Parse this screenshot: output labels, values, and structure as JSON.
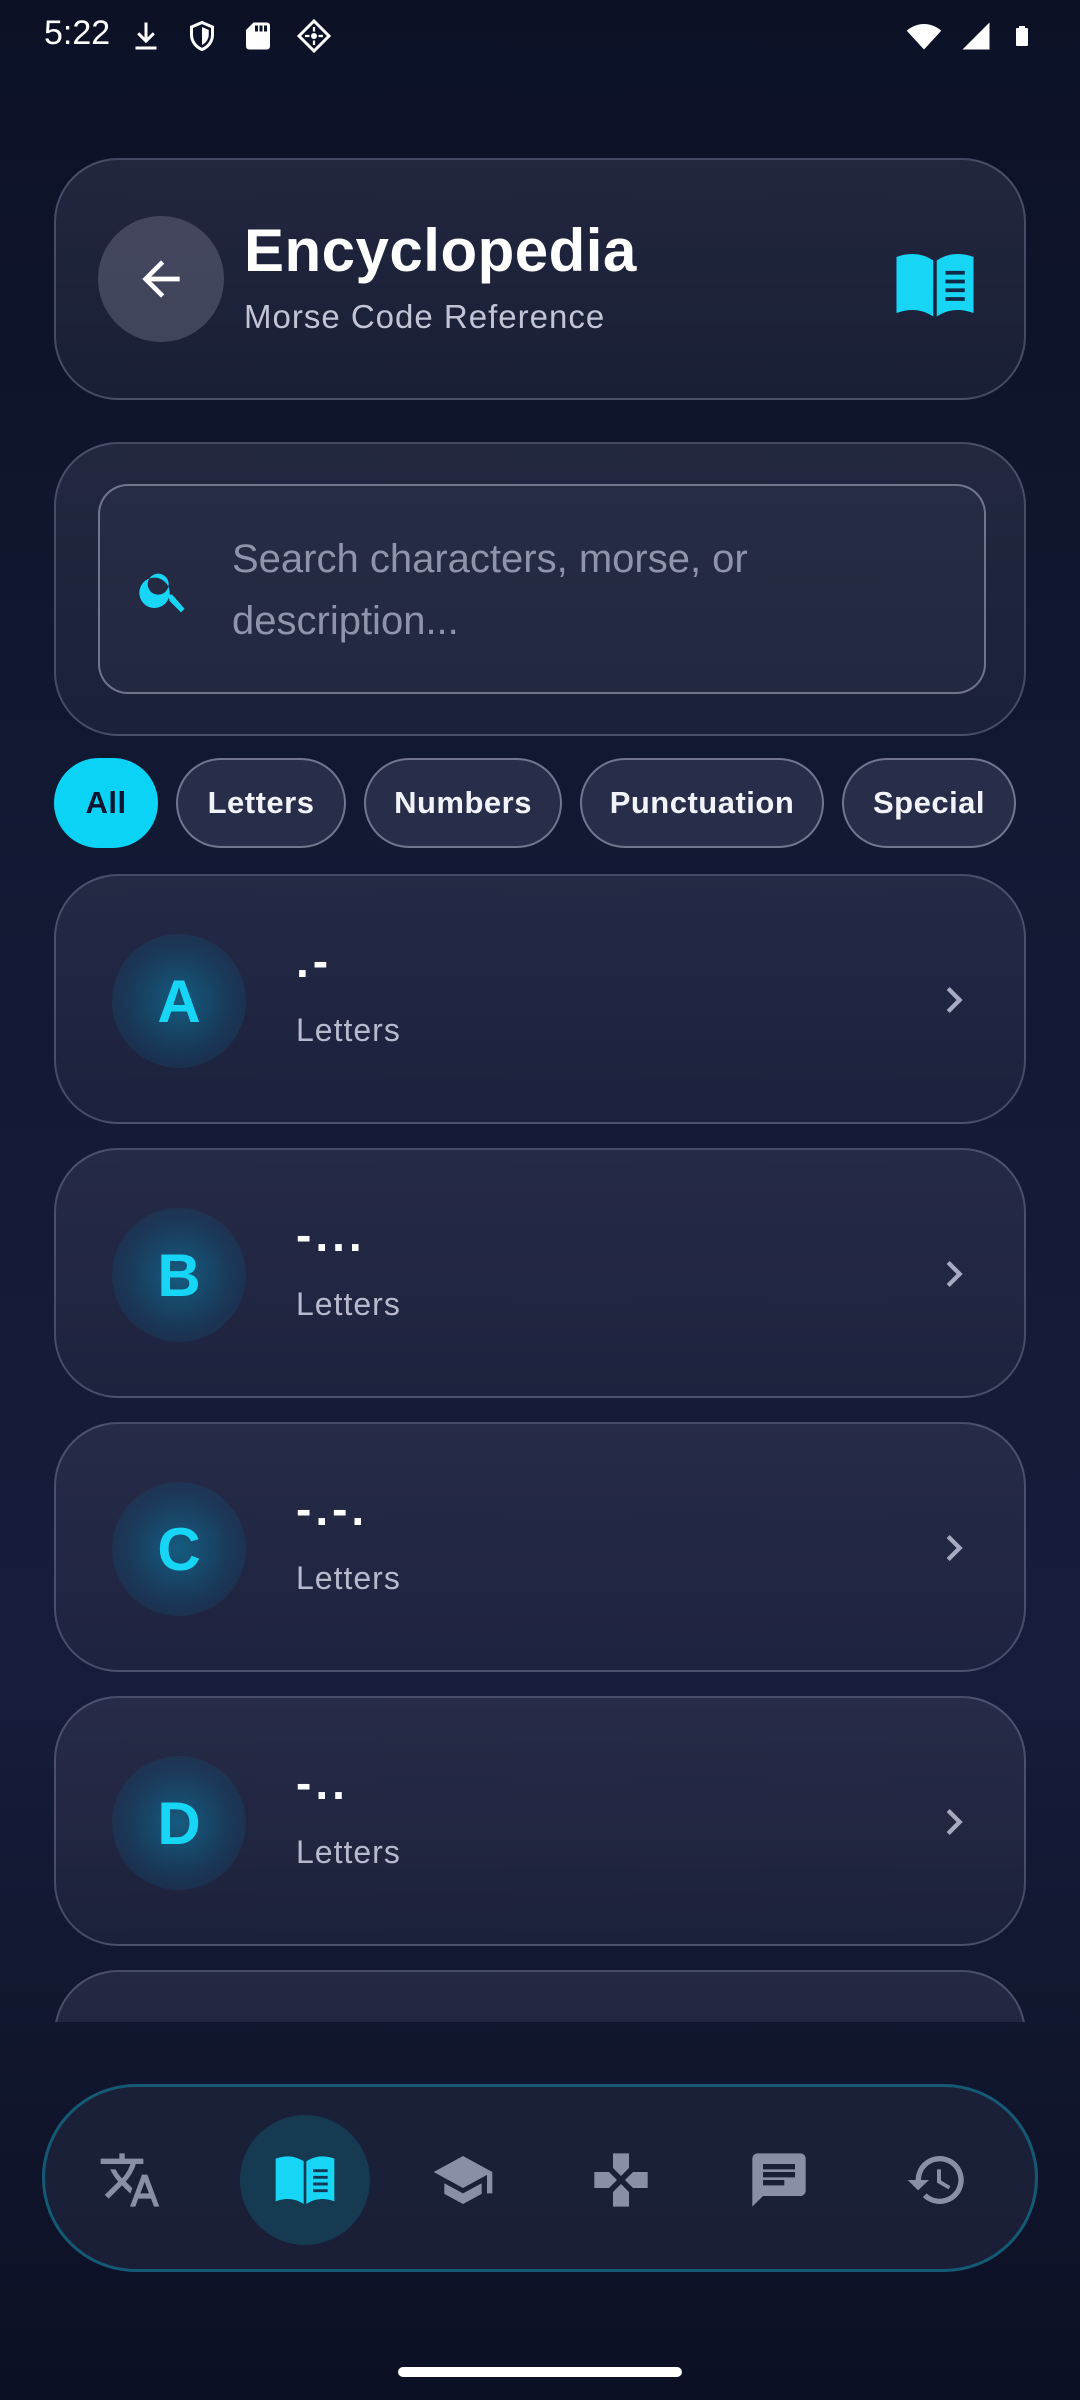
{
  "status_bar": {
    "time": "5:22",
    "icons_left": [
      "download-icon",
      "shield-icon",
      "sd-card-icon",
      "device-icon"
    ],
    "icons_right": [
      "wifi-icon",
      "signal-icon",
      "battery-icon"
    ]
  },
  "header": {
    "title": "Encyclopedia",
    "subtitle": "Morse Code Reference",
    "back_icon": "arrow-left-icon",
    "right_icon": "book-icon"
  },
  "search": {
    "placeholder": "Search characters, morse, or description...",
    "icon": "search-icon"
  },
  "filters": [
    {
      "label": "All",
      "active": true
    },
    {
      "label": "Letters",
      "active": false
    },
    {
      "label": "Numbers",
      "active": false
    },
    {
      "label": "Punctuation",
      "active": false
    },
    {
      "label": "Special",
      "active": false
    }
  ],
  "entries": [
    {
      "char": "A",
      "morse": ".-",
      "category": "Letters"
    },
    {
      "char": "B",
      "morse": "-...",
      "category": "Letters"
    },
    {
      "char": "C",
      "morse": "-.-.",
      "category": "Letters"
    },
    {
      "char": "D",
      "morse": "-..",
      "category": "Letters"
    }
  ],
  "bottom_nav": [
    {
      "name": "translate",
      "icon": "translate-icon",
      "active": false
    },
    {
      "name": "encyclopedia",
      "icon": "book-icon",
      "active": true
    },
    {
      "name": "learn",
      "icon": "school-icon",
      "active": false
    },
    {
      "name": "games",
      "icon": "gamepad-icon",
      "active": false
    },
    {
      "name": "chat",
      "icon": "message-icon",
      "active": false
    },
    {
      "name": "history",
      "icon": "history-icon",
      "active": false
    }
  ],
  "colors": {
    "accent": "#0bd3f5",
    "background": "#0c1126",
    "card_border": "#5f6585",
    "nav_border": "#145a74"
  }
}
